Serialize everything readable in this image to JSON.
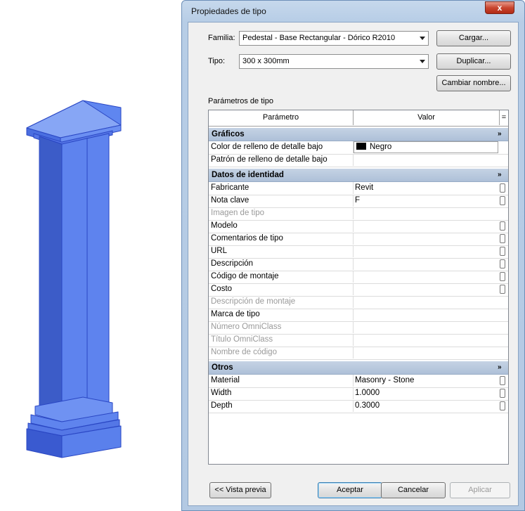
{
  "dialog": {
    "title": "Propiedades de tipo",
    "close_label": "x"
  },
  "family": {
    "label": "Familia:",
    "value": "Pedestal - Base Rectangular - Dórico R2010"
  },
  "type": {
    "label": "Tipo:",
    "value": "300 x 300mm"
  },
  "buttons": {
    "load": "Cargar...",
    "duplicate": "Duplicar...",
    "rename": "Cambiar nombre...",
    "preview": "<< Vista previa",
    "ok": "Aceptar",
    "cancel": "Cancelar",
    "apply": "Aplicar"
  },
  "section_label": "Parámetros de tipo",
  "columns": {
    "param": "Parámetro",
    "value": "Valor",
    "sort": "="
  },
  "groups": [
    {
      "name": "Gráficos",
      "chevron": "»",
      "rows": [
        {
          "name": "Color de relleno de detalle bajo",
          "value": "Negro",
          "swatch": "#000000"
        },
        {
          "name": "Patrón de relleno de detalle bajo",
          "value": ""
        }
      ]
    },
    {
      "name": "Datos de identidad",
      "chevron": "»",
      "rows": [
        {
          "name": "Fabricante",
          "value": "Revit"
        },
        {
          "name": "Nota clave",
          "value": "F"
        },
        {
          "name": "Imagen de tipo",
          "value": ""
        },
        {
          "name": "Modelo",
          "value": ""
        },
        {
          "name": "Comentarios de tipo",
          "value": ""
        },
        {
          "name": "URL",
          "value": ""
        },
        {
          "name": "Descripción",
          "value": ""
        },
        {
          "name": "Código de montaje",
          "value": ""
        },
        {
          "name": "Costo",
          "value": ""
        },
        {
          "name": "Descripción de montaje",
          "value": ""
        },
        {
          "name": "Marca de tipo",
          "value": ""
        },
        {
          "name": "Número OmniClass",
          "value": ""
        },
        {
          "name": "Título OmniClass",
          "value": ""
        },
        {
          "name": "Nombre de código",
          "value": ""
        }
      ]
    },
    {
      "name": "Otros",
      "chevron": "»",
      "rows": [
        {
          "name": "Material",
          "value": "Masonry - Stone"
        },
        {
          "name": "Width",
          "value": "1.0000"
        },
        {
          "name": "Depth",
          "value": "0.3000"
        }
      ]
    }
  ],
  "colors": {
    "pedestal_fill": "#4a6fe0",
    "pedestal_stroke": "#1f3aa8",
    "group_header": "#b7c7dc"
  }
}
